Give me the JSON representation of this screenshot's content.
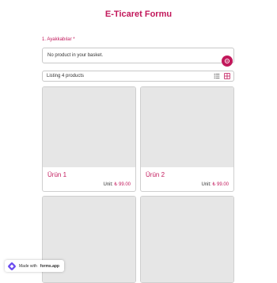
{
  "header": {
    "title": "E-Ticaret Formu"
  },
  "question": {
    "label": "1.  Ayakkabılar",
    "required_mark": "*"
  },
  "basket": {
    "empty_text": "No product in your basket."
  },
  "listing": {
    "text": "Listing 4 products"
  },
  "products": [
    {
      "name": "Ürün 1",
      "unit_label": "Unit:",
      "price": "₺ 99.00"
    },
    {
      "name": "Ürün 2",
      "unit_label": "Unit:",
      "price": "₺ 99.00"
    },
    {
      "name": "",
      "unit_label": "",
      "price": ""
    },
    {
      "name": "",
      "unit_label": "",
      "price": ""
    }
  ],
  "badge": {
    "prefix": "Made with",
    "brand": "forms.app"
  },
  "colors": {
    "accent": "#c2185b",
    "placeholder": "#e6e6e6",
    "border": "#c9c9c9"
  }
}
